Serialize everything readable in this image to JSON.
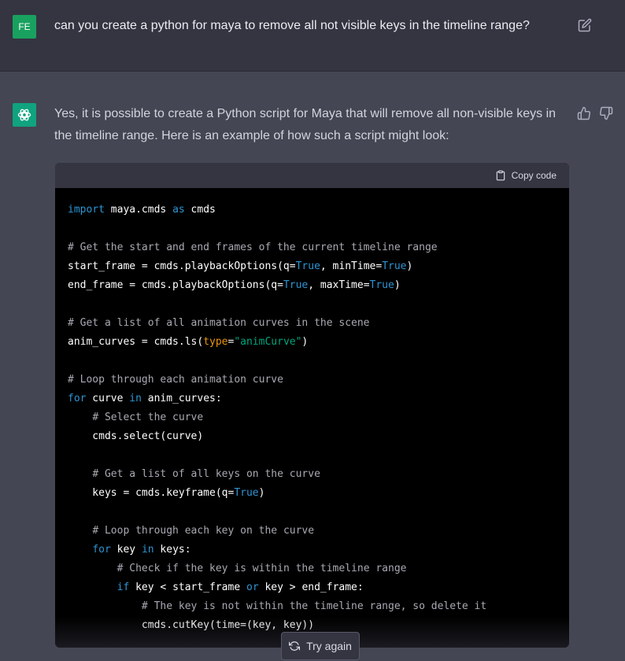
{
  "user_message": {
    "avatar_initials": "FE",
    "avatar_color": "#19a15f",
    "text": "can you create a python for maya to remove all not visible keys in the timeline range?"
  },
  "assistant_message": {
    "avatar_color": "#10a37f",
    "intro": "Yes, it is possible to create a Python script for Maya that will remove all non-visible keys in the timeline range. Here is an example of how such a script might look:",
    "copy_label": "Copy code",
    "code_lines": [
      "import maya.cmds as cmds",
      "",
      "# Get the start and end frames of the current timeline range",
      "start_frame = cmds.playbackOptions(q=True, minTime=True)",
      "end_frame = cmds.playbackOptions(q=True, maxTime=True)",
      "",
      "# Get a list of all animation curves in the scene",
      "anim_curves = cmds.ls(type=\"animCurve\")",
      "",
      "# Loop through each animation curve",
      "for curve in anim_curves:",
      "    # Select the curve",
      "    cmds.select(curve)",
      "",
      "    # Get a list of all keys on the curve",
      "    keys = cmds.keyframe(q=True)",
      "",
      "    # Loop through each key on the curve",
      "    for key in keys:",
      "        # Check if the key is within the timeline range",
      "        if key < start_frame or key > end_frame:",
      "            # The key is not within the timeline range, so delete it",
      "            cmds.cutKey(time=(key, key))"
    ]
  },
  "try_again_label": "Try again",
  "colors": {
    "page_bg": "#444654",
    "user_row_bg": "#343541",
    "keyword": "#2e95d3",
    "comment": "#a9a9b3",
    "string": "#00a67d",
    "param": "#e9950c"
  },
  "icons": [
    "edit-icon",
    "openai-logo-icon",
    "thumbs-up-icon",
    "thumbs-down-icon",
    "clipboard-icon",
    "refresh-icon"
  ]
}
